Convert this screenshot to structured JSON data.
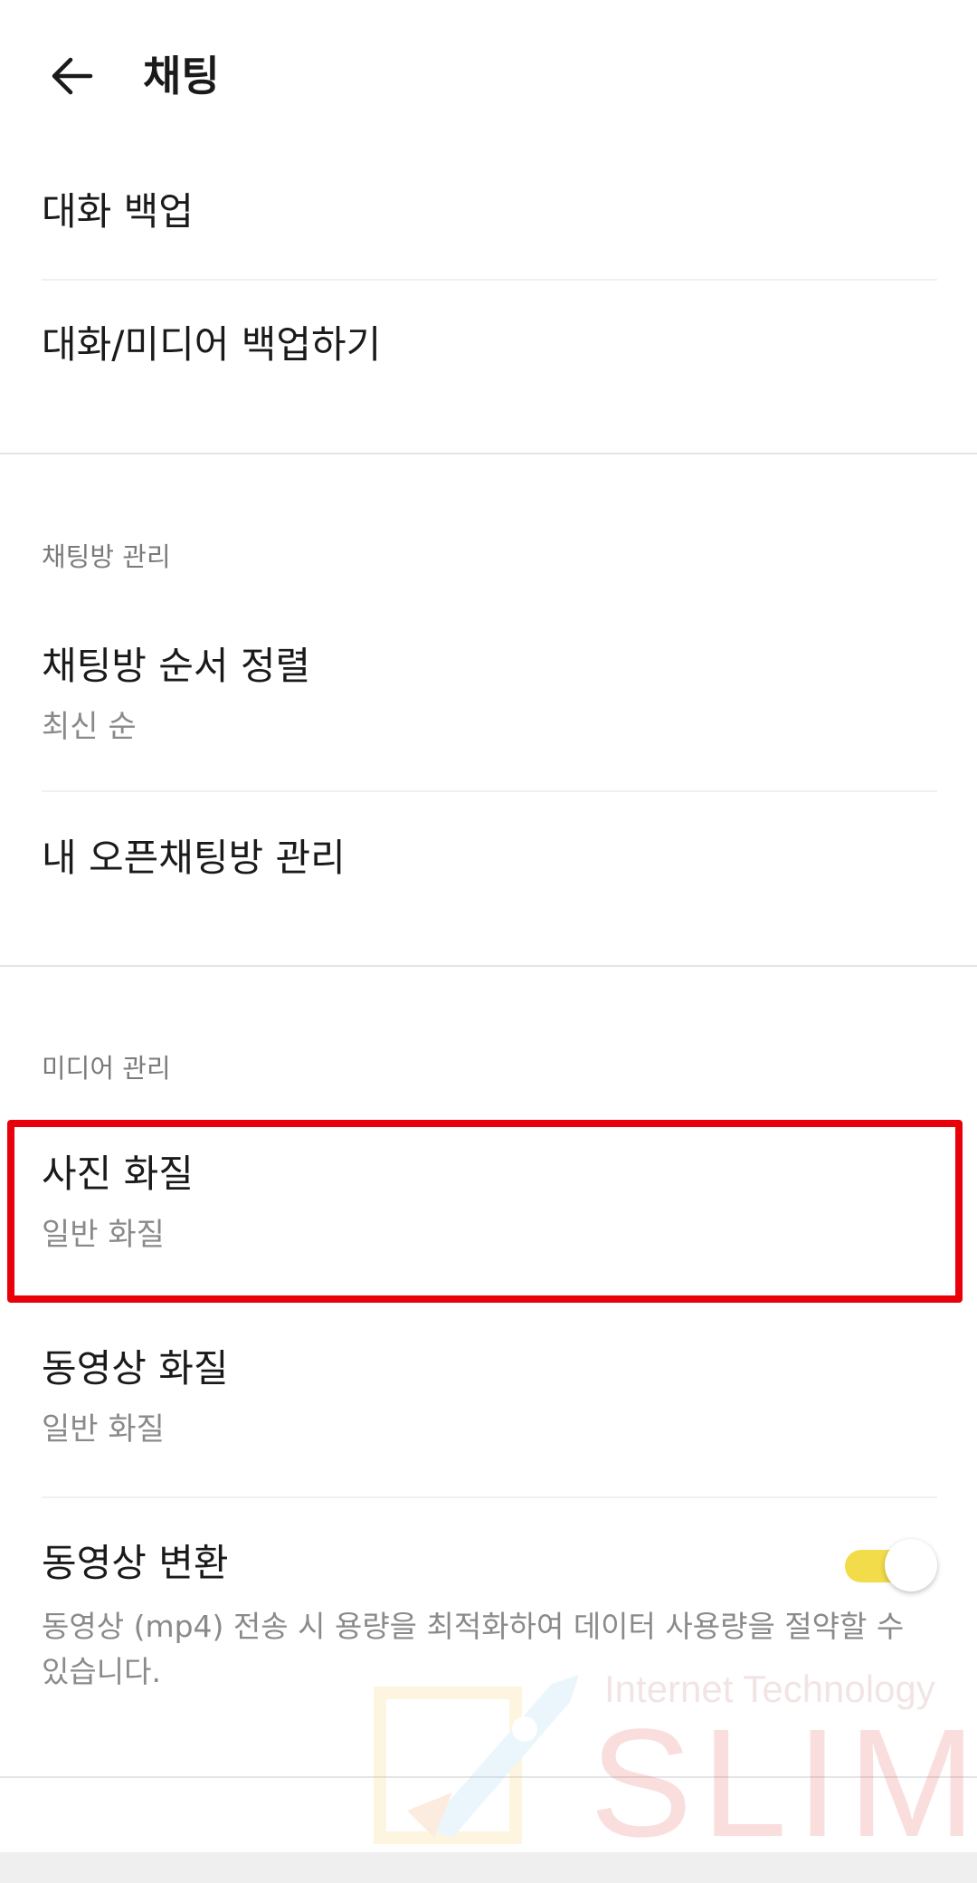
{
  "header": {
    "title": "채팅",
    "back_icon": "arrow-left-icon"
  },
  "backup_section": {
    "items": [
      {
        "label": "대화 백업"
      },
      {
        "label": "대화/미디어 백업하기"
      }
    ]
  },
  "chatroom_section": {
    "header": "채팅방 관리",
    "sort": {
      "label": "채팅방 순서 정렬",
      "value": "최신 순"
    },
    "open_chat": {
      "label": "내 오픈채팅방 관리"
    }
  },
  "media_section": {
    "header": "미디어 관리",
    "photo_quality": {
      "label": "사진 화질",
      "value": "일반 화질"
    },
    "video_quality": {
      "label": "동영상 화질",
      "value": "일반 화질"
    },
    "video_convert": {
      "label": "동영상 변환",
      "description": "동영상 (mp4) 전송 시 용량을 최적화하여 데이터 사용량을 절약할 수 있습니다.",
      "enabled": true
    }
  },
  "watermark": {
    "small_text": "Internet Technology",
    "big_text": "SLIM"
  },
  "colors": {
    "highlight": "#e8000b",
    "toggle_on": "#f2dc4a"
  }
}
